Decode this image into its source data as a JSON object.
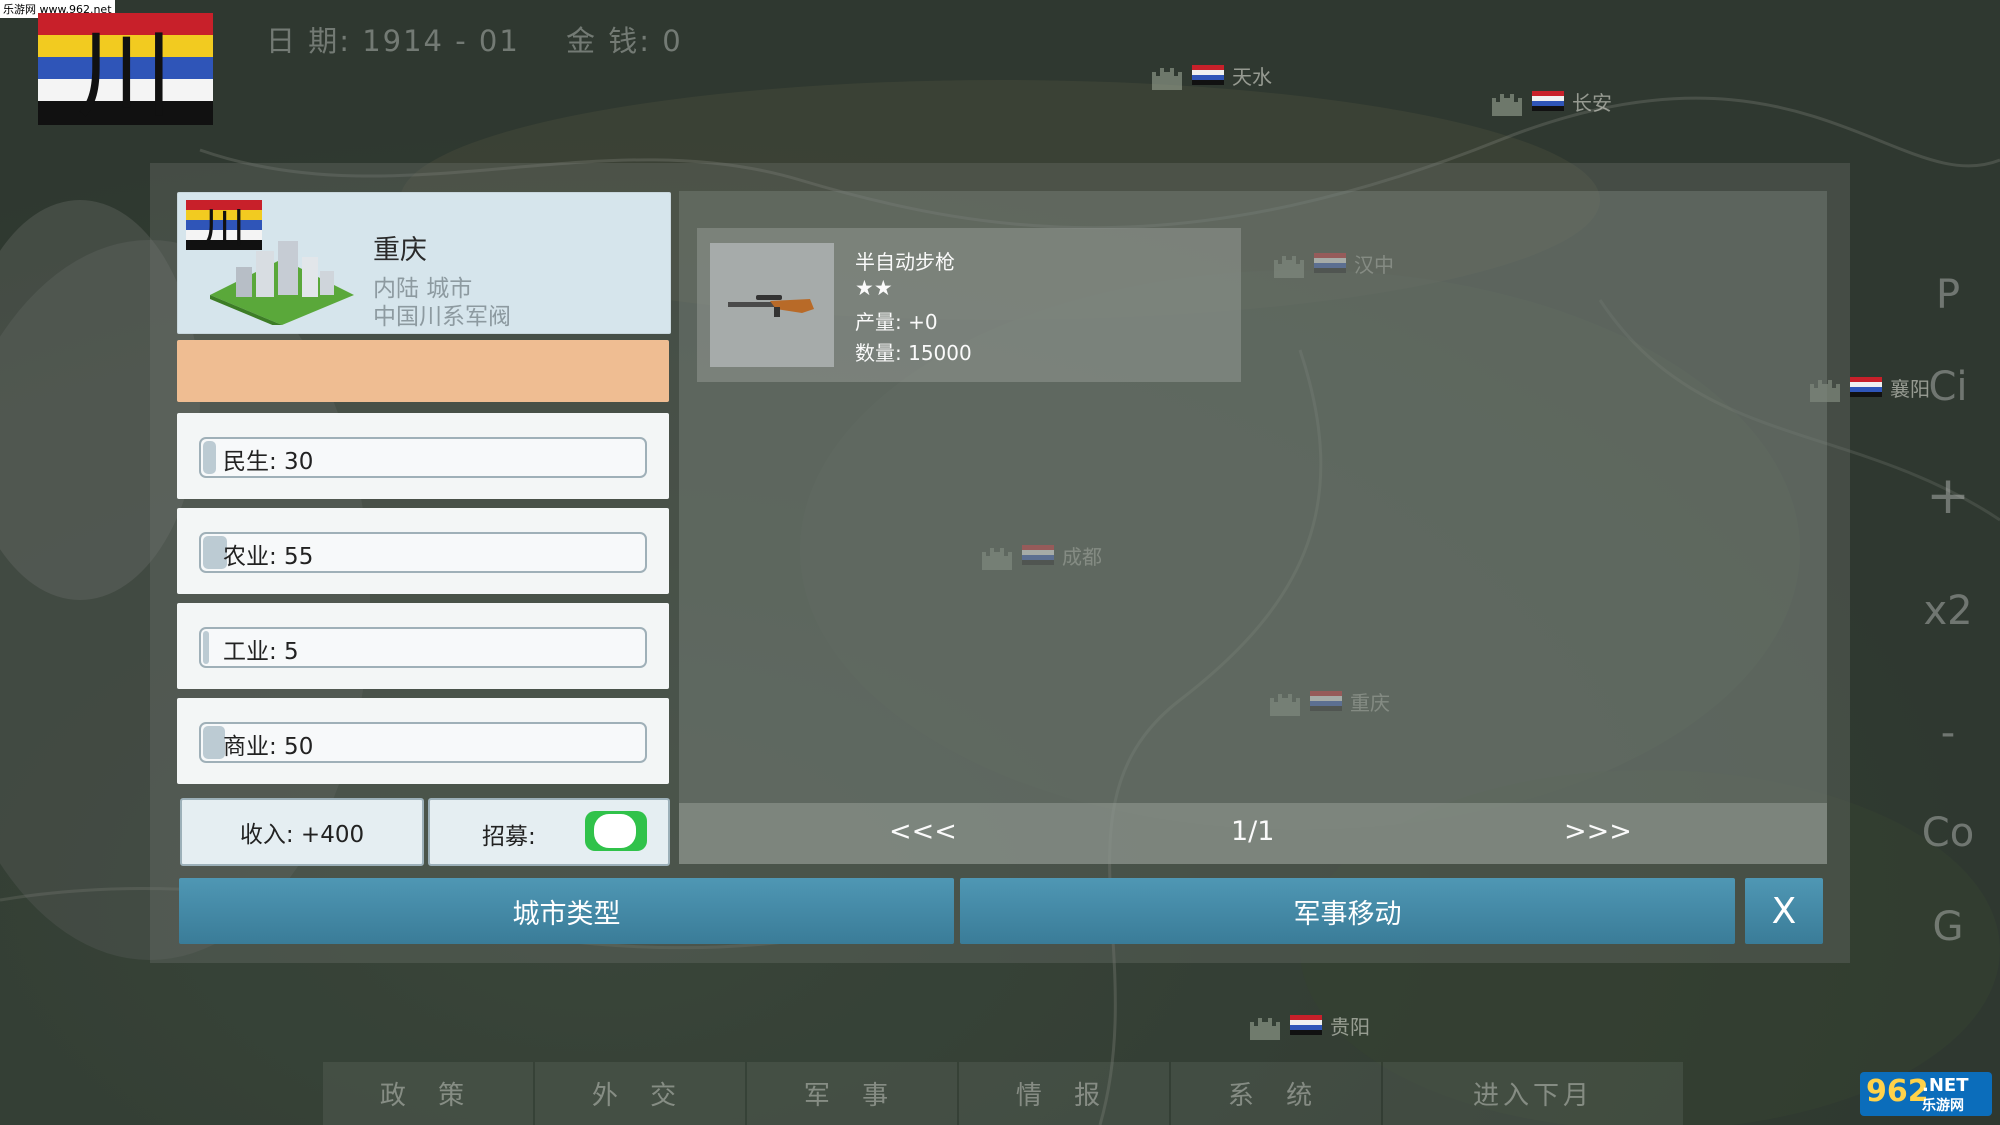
{
  "watermark": "乐游网 www.962.net",
  "top_bar": {
    "flag_char": "川",
    "date": "日 期: 1914 - 01",
    "money": "金 钱: 0"
  },
  "map_cities": [
    {
      "name": "天水"
    },
    {
      "name": "长安"
    },
    {
      "name": "汉中"
    },
    {
      "name": "襄阳"
    },
    {
      "name": "成都"
    },
    {
      "name": "重庆"
    },
    {
      "name": "贵阳"
    }
  ],
  "right_controls": [
    "P",
    "Ci",
    "+",
    "x2",
    "-",
    "Co",
    "G"
  ],
  "city_panel": {
    "flag_char": "川",
    "name": "重庆",
    "type": "内陆 城市",
    "owner": "中国川系军阀",
    "stats": [
      {
        "label": "民生: 30",
        "level": 30
      },
      {
        "label": "农业: 55",
        "level": 55
      },
      {
        "label": "工业: 5",
        "level": 5
      },
      {
        "label": "商业: 50",
        "level": 50
      }
    ],
    "income": "收入: +400",
    "recruit_label": "招募:",
    "recruit_on": true
  },
  "units": [
    {
      "name": "半自动步枪",
      "stars": "★★",
      "production": "产量: +0",
      "quantity": "数量: 15000"
    }
  ],
  "pager": {
    "prev": "<<<",
    "page": "1/1",
    "next": ">>>"
  },
  "actions": {
    "city_type": "城市类型",
    "military_move": "军事移动",
    "close": "X"
  },
  "bottom_menu": [
    "政 策",
    "外 交",
    "军 事",
    "情 报",
    "系 统",
    "进入下月"
  ],
  "logo": {
    "main": "962",
    "suffix": ".NET",
    "sub": "乐游网"
  },
  "colors": {
    "accent_button": "#4589a7",
    "orange_bar": "#efbd92",
    "toggle_on": "#30c24a"
  }
}
